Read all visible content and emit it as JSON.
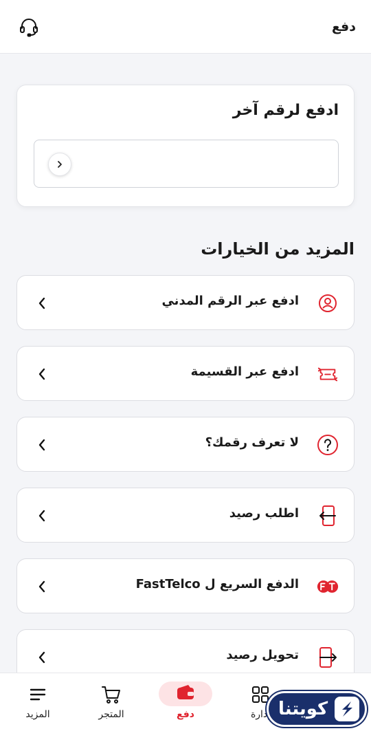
{
  "header": {
    "title": "دفع",
    "support_icon": "headset-icon"
  },
  "pay_card": {
    "title": "ادفع لرقم آخر",
    "input_value": "",
    "input_placeholder": ""
  },
  "more_options": {
    "title": "المزيد من الخيارات",
    "items": [
      {
        "label": "ادفع عبر الرقم المدني",
        "icon": "civil-id-icon"
      },
      {
        "label": "ادفع عبر القسيمة",
        "icon": "voucher-icon"
      },
      {
        "label": "لا تعرف رقمك؟",
        "icon": "question-icon"
      },
      {
        "label": "اطلب رصيد",
        "icon": "request-credit-icon"
      },
      {
        "label": "الدفع السريع ل FastTelco",
        "icon": "fasttelco-icon"
      },
      {
        "label": "تحويل رصيد",
        "icon": "transfer-credit-icon"
      }
    ]
  },
  "bottom_nav": {
    "items": [
      {
        "label": "المزيد",
        "icon": "menu-icon",
        "active": false
      },
      {
        "label": "المتجر",
        "icon": "cart-icon",
        "active": false
      },
      {
        "label": "دفع",
        "icon": "wallet-icon",
        "active": true
      },
      {
        "label": "إدارة",
        "icon": "apps-icon",
        "active": false
      },
      {
        "label": "",
        "icon": "chevron-up-icon",
        "active": false
      }
    ]
  },
  "watermark": {
    "text": "كويتنا"
  },
  "colors": {
    "accent": "#e0242f",
    "background": "#f4f5f8",
    "active_pill": "#fde3e5"
  }
}
